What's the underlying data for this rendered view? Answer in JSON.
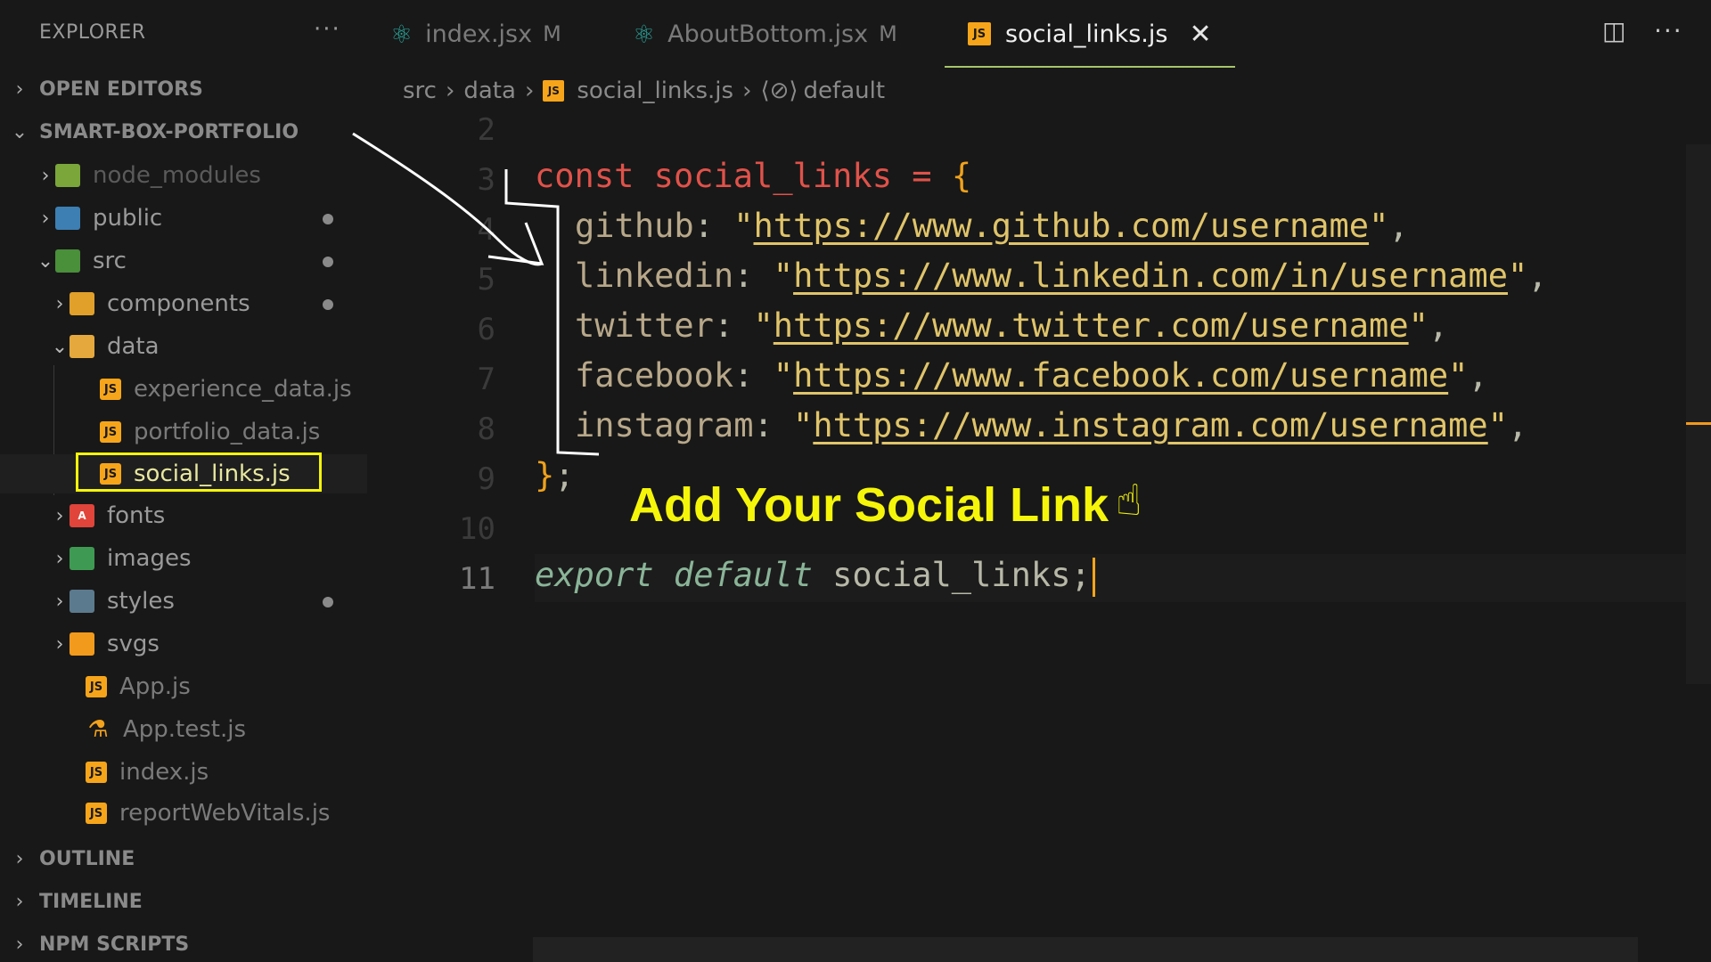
{
  "explorer": {
    "title": "EXPLORER",
    "more": "···",
    "sections": {
      "open_editors": "OPEN EDITORS",
      "project": "SMART-BOX-PORTFOLIO",
      "outline": "OUTLINE",
      "timeline": "TIMELINE",
      "npm_scripts": "NPM SCRIPTS"
    },
    "tree": {
      "node_modules": "node_modules",
      "public": "public",
      "src": "src",
      "components": "components",
      "data": "data",
      "experience_data": "experience_data.js",
      "portfolio_data": "portfolio_data.js",
      "social_links": "social_links.js",
      "fonts": "fonts",
      "images": "images",
      "styles": "styles",
      "svgs": "svgs",
      "app_js": "App.js",
      "app_test": "App.test.js",
      "index_js": "index.js",
      "report": "reportWebVitals.js"
    }
  },
  "tabs": [
    {
      "label": "index.jsx",
      "badge": "M"
    },
    {
      "label": "AboutBottom.jsx",
      "badge": "M"
    },
    {
      "label": "social_links.js",
      "close": "✕"
    }
  ],
  "breadcrumb": {
    "src": "src",
    "data": "data",
    "file": "social_links.js",
    "symbol": "default"
  },
  "editor": {
    "line_numbers": [
      "2",
      "3",
      "4",
      "5",
      "6",
      "7",
      "8",
      "9",
      "10",
      "11"
    ],
    "code": {
      "const": "const",
      "name": "social_links",
      "eq": "=",
      "open": "{",
      "github_key": "github",
      "github_url": "https://www.github.com/username",
      "linkedin_key": "linkedin",
      "linkedin_url": "https://www.linkedin.com/in/username",
      "twitter_key": "twitter",
      "twitter_url": "https://www.twitter.com/username",
      "facebook_key": "facebook",
      "facebook_url": "https://www.facebook.com/username",
      "instagram_key": "instagram",
      "instagram_url": "https://www.instagram.com/username",
      "close": "}",
      "export": "export default",
      "export_name": "social_links;"
    },
    "annotation": "Add Your Social Link"
  },
  "colors": {
    "highlight": "#f5f50a",
    "js_icon": "#f6a51a",
    "active_tab_underline": "#a6c46a"
  }
}
